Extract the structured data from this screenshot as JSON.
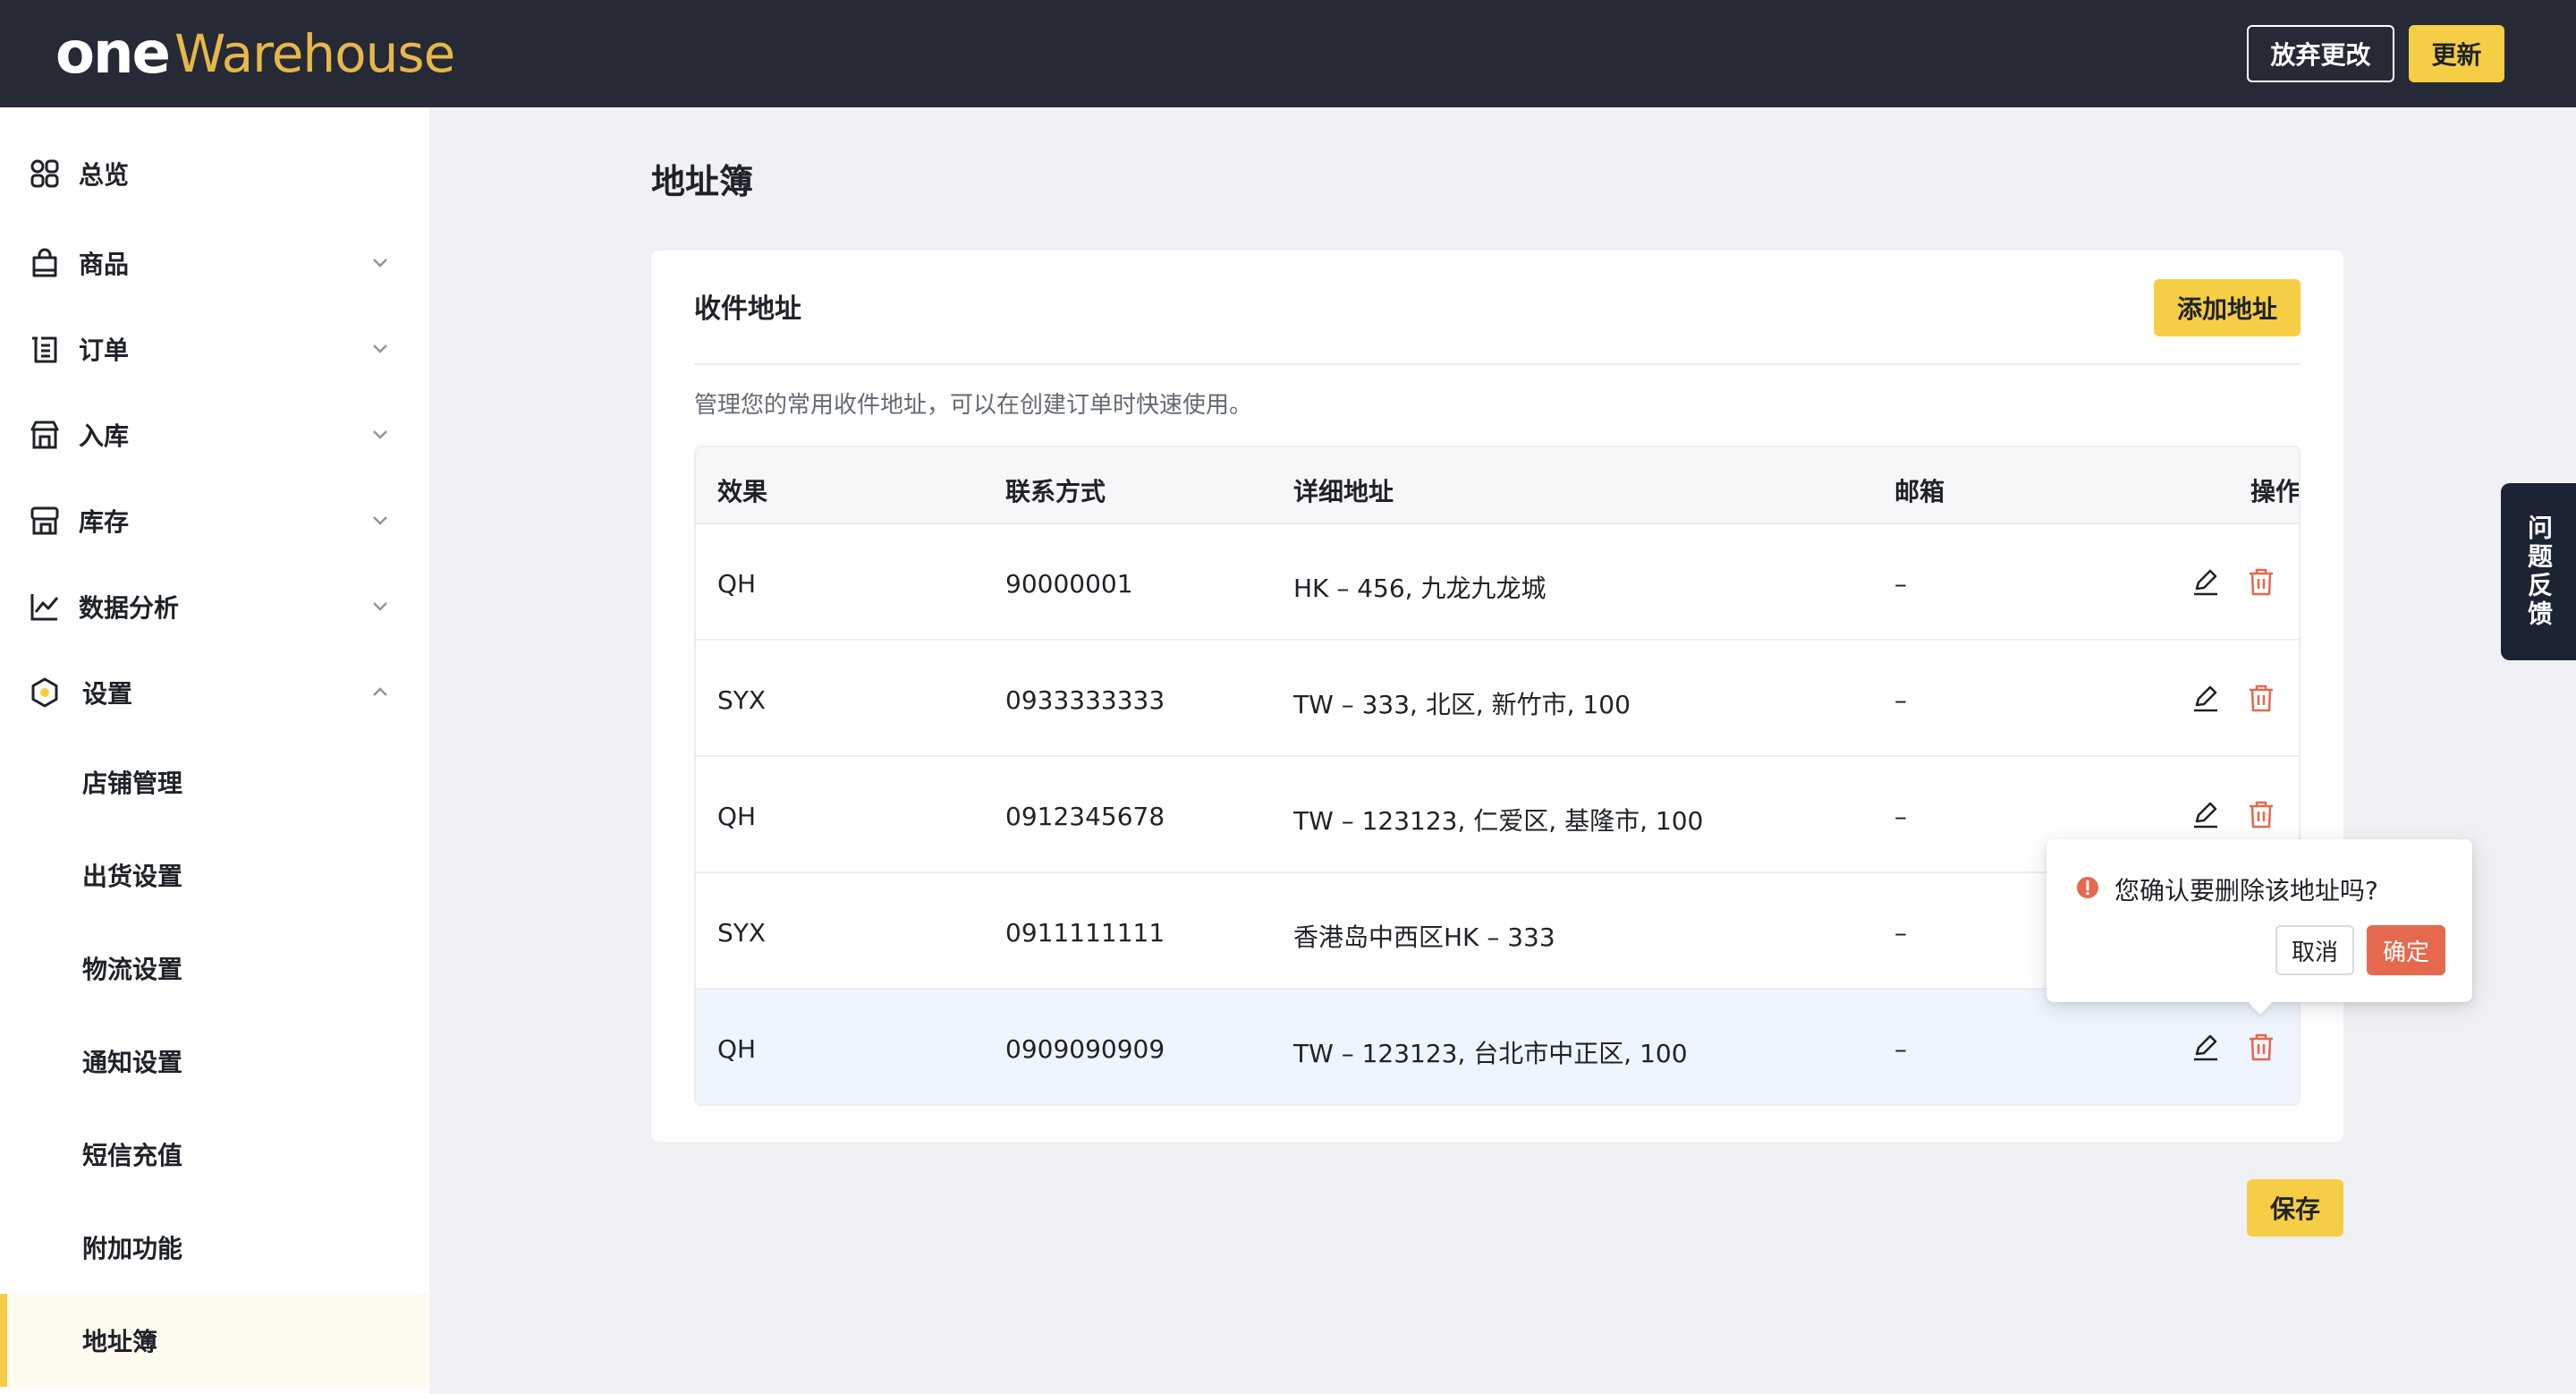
{
  "header": {
    "logo_one": "one",
    "logo_warehouse": "Warehouse",
    "discard_label": "放弃更改",
    "update_label": "更新"
  },
  "sidebar": {
    "items": [
      {
        "label": "总览",
        "icon": "dashboard-icon"
      },
      {
        "label": "商品",
        "icon": "bag-icon"
      },
      {
        "label": "订单",
        "icon": "order-icon"
      },
      {
        "label": "入库",
        "icon": "inbound-icon"
      },
      {
        "label": "库存",
        "icon": "inventory-icon"
      },
      {
        "label": "数据分析",
        "icon": "chart-icon"
      },
      {
        "label": "设置",
        "icon": "settings-hexagon-icon"
      }
    ],
    "sub_items": [
      {
        "label": "店铺管理"
      },
      {
        "label": "出货设置"
      },
      {
        "label": "物流设置"
      },
      {
        "label": "通知设置"
      },
      {
        "label": "短信充值"
      },
      {
        "label": "附加功能"
      },
      {
        "label": "地址簿",
        "active": true
      }
    ]
  },
  "main": {
    "page_title": "地址簿",
    "card_title": "收件地址",
    "add_label": "添加地址",
    "description": "管理您的常用收件地址，可以在创建订单时快速使用。",
    "save_label": "保存"
  },
  "table": {
    "headers": [
      "效果",
      "联系方式",
      "详细地址",
      "邮箱",
      "操作"
    ],
    "rows": [
      {
        "name": "QH",
        "phone": "90000001",
        "address": "HK – 456, 九龙九龙城",
        "email": "–"
      },
      {
        "name": "SYX",
        "phone": "0933333333",
        "address": "TW – 333, 北区, 新竹市, 100",
        "email": "–"
      },
      {
        "name": "QH",
        "phone": "0912345678",
        "address": "TW – 123123, 仁爱区, 基隆市, 100",
        "email": "–"
      },
      {
        "name": "SYX",
        "phone": "0911111111",
        "address": "香港岛中西区HK – 333",
        "email": "–"
      },
      {
        "name": "QH",
        "phone": "0909090909",
        "address": "TW – 123123, 台北市中正区, 100",
        "email": "–"
      }
    ]
  },
  "feedback": {
    "label": "问题反馈"
  },
  "popconfirm": {
    "message": "您确认要删除该地址吗?",
    "cancel_label": "取消",
    "ok_label": "确定"
  },
  "colors": {
    "accent": "#f6ce45",
    "topbar": "#262a36",
    "danger": "#e5694e",
    "feedback_bg": "#1c2333"
  }
}
